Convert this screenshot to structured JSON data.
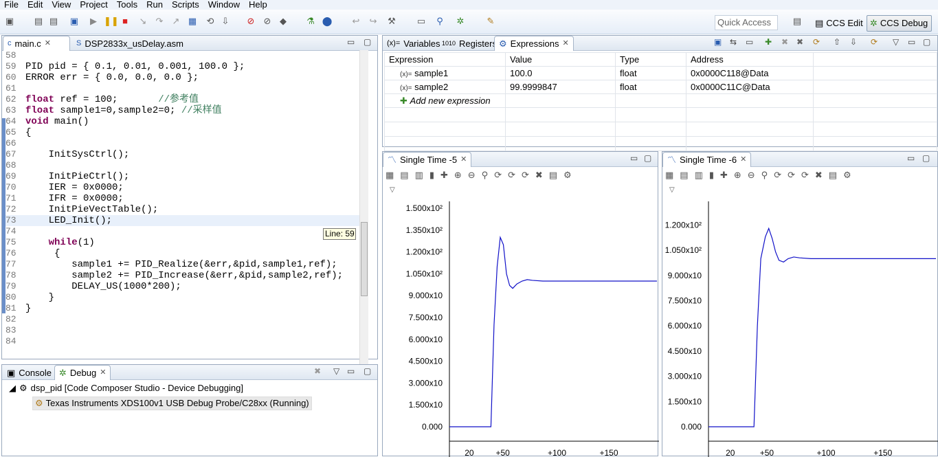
{
  "menu": [
    "File",
    "Edit",
    "View",
    "Project",
    "Tools",
    "Run",
    "Scripts",
    "Window",
    "Help"
  ],
  "toolbar": {
    "quick_access_placeholder": "Quick Access",
    "ccs_edit": "CCS Edit",
    "ccs_debug": "CCS Debug"
  },
  "editor": {
    "tabs": [
      {
        "label": "main.c",
        "close": "✕"
      },
      {
        "label": "DSP2833x_usDelay.asm"
      }
    ],
    "tooltip": "Line: 59",
    "lines": [
      {
        "n": "58",
        "text": ""
      },
      {
        "n": "59",
        "text": "PID pid = { 0.1, 0.01, 0.001, 100.0 };"
      },
      {
        "n": "60",
        "text": "ERROR err = { 0.0, 0.0, 0.0 };"
      },
      {
        "n": "61",
        "text": ""
      },
      {
        "n": "62",
        "kw": "float",
        "text": " ref = 100;       ",
        "comment": "//参考值"
      },
      {
        "n": "63",
        "kw": "float",
        "text": " sample1=0,sample2=0; ",
        "comment": "//采样值"
      },
      {
        "n": "64",
        "kw": "void",
        "text": " main()"
      },
      {
        "n": "65",
        "text": "{"
      },
      {
        "n": "66",
        "text": ""
      },
      {
        "n": "67",
        "text": "    InitSysCtrl();"
      },
      {
        "n": "68",
        "text": ""
      },
      {
        "n": "69",
        "text": "    InitPieCtrl();"
      },
      {
        "n": "70",
        "text": "    IER = 0x0000;"
      },
      {
        "n": "71",
        "text": "    IFR = 0x0000;"
      },
      {
        "n": "72",
        "text": "    InitPieVectTable();"
      },
      {
        "n": "73",
        "text": "    LED_Init();"
      },
      {
        "n": "74",
        "text": ""
      },
      {
        "n": "75",
        "pre": "    ",
        "kw": "while",
        "text": "(1)"
      },
      {
        "n": "76",
        "text": "     {"
      },
      {
        "n": "77",
        "text": "        sample1 += PID_Realize(&err,&pid,sample1,ref);"
      },
      {
        "n": "78",
        "text": "        sample2 += PID_Increase(&err,&pid,sample2,ref);"
      },
      {
        "n": "79",
        "text": "        DELAY_US(1000*200);"
      },
      {
        "n": "80",
        "text": "    }"
      },
      {
        "n": "81",
        "text": "}"
      },
      {
        "n": "82",
        "text": ""
      },
      {
        "n": "83",
        "text": ""
      },
      {
        "n": "84",
        "text": ""
      }
    ]
  },
  "debugview": {
    "tabs": [
      "Console",
      "Debug"
    ],
    "session": "dsp_pid [Code Composer Studio - Device Debugging]",
    "target": "Texas Instruments XDS100v1 USB Debug Probe/C28xx (Running)"
  },
  "expressions": {
    "tabs": [
      "Variables",
      "Registers",
      "Expressions"
    ],
    "columns": [
      "Expression",
      "Value",
      "Type",
      "Address"
    ],
    "rows": [
      {
        "name": "sample1",
        "value": "100.0",
        "type": "float",
        "address": "0x0000C118@Data"
      },
      {
        "name": "sample2",
        "value": "99.9999847",
        "type": "float",
        "address": "0x0000C11C@Data"
      }
    ],
    "add_label": "Add new expression"
  },
  "chart_data": [
    {
      "type": "line",
      "title": "Single Time -5",
      "ylim": [
        0,
        150
      ],
      "yticks": [
        "1.500x10²",
        "1.350x10²",
        "1.200x10²",
        "1.050x10²",
        "9.000x10",
        "7.500x10",
        "6.000x10",
        "4.500x10",
        "3.000x10",
        "1.500x10",
        "0.000"
      ],
      "xticks": [
        "20",
        "+50",
        "+100",
        "+150"
      ],
      "x": [
        0,
        40,
        43,
        46,
        49,
        52,
        55,
        58,
        61,
        65,
        70,
        75,
        80,
        90,
        100,
        120,
        140,
        160,
        200
      ],
      "y": [
        0,
        0,
        70,
        110,
        130,
        125,
        105,
        97,
        95,
        98,
        100,
        101,
        100.5,
        100,
        100,
        100,
        100,
        100,
        100
      ]
    },
    {
      "type": "line",
      "title": "Single Time -6",
      "ylim": [
        0,
        130
      ],
      "yticks": [
        "1.200x10²",
        "1.050x10²",
        "9.000x10",
        "7.500x10",
        "6.000x10",
        "4.500x10",
        "3.000x10",
        "1.500x10",
        "0.000"
      ],
      "xticks": [
        "20",
        "+50",
        "+100",
        "+150"
      ],
      "x": [
        0,
        40,
        43,
        46,
        50,
        53,
        56,
        59,
        62,
        66,
        70,
        75,
        80,
        90,
        100,
        140,
        200
      ],
      "y": [
        0,
        0,
        60,
        100,
        113,
        118,
        112,
        104,
        99,
        98,
        100,
        101,
        100.5,
        100,
        100,
        100,
        100
      ]
    }
  ]
}
